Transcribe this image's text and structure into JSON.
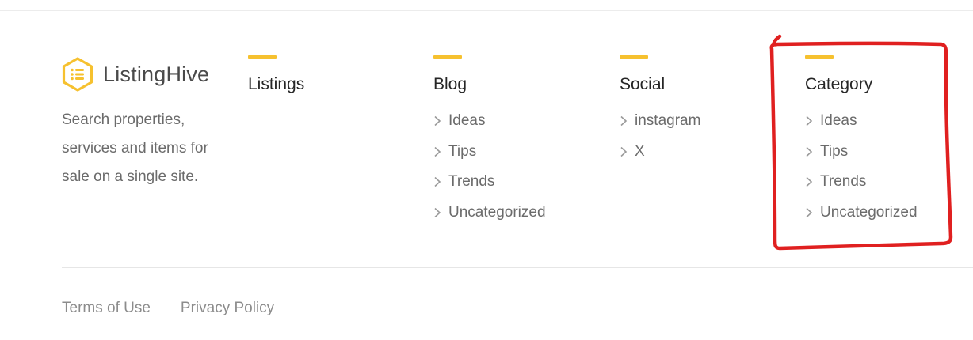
{
  "brand": {
    "name": "ListingHive",
    "tagline": "Search properties, services and items for sale on a single site."
  },
  "columns": {
    "listings": {
      "title": "Listings",
      "items": []
    },
    "blog": {
      "title": "Blog",
      "items": [
        "Ideas",
        "Tips",
        "Trends",
        "Uncategorized"
      ]
    },
    "social": {
      "title": "Social",
      "items": [
        "instagram",
        "X"
      ]
    },
    "category": {
      "title": "Category",
      "items": [
        "Ideas",
        "Tips",
        "Trends",
        "Uncategorized"
      ]
    }
  },
  "legal": {
    "terms": "Terms of Use",
    "privacy": "Privacy Policy"
  },
  "colors": {
    "accent": "#f6c12f",
    "annotation": "#e02020"
  },
  "icons": {
    "logo": "hexagon-list-logo-icon",
    "bullet": "chevron-right-icon",
    "markup": "red-highlight-box"
  }
}
